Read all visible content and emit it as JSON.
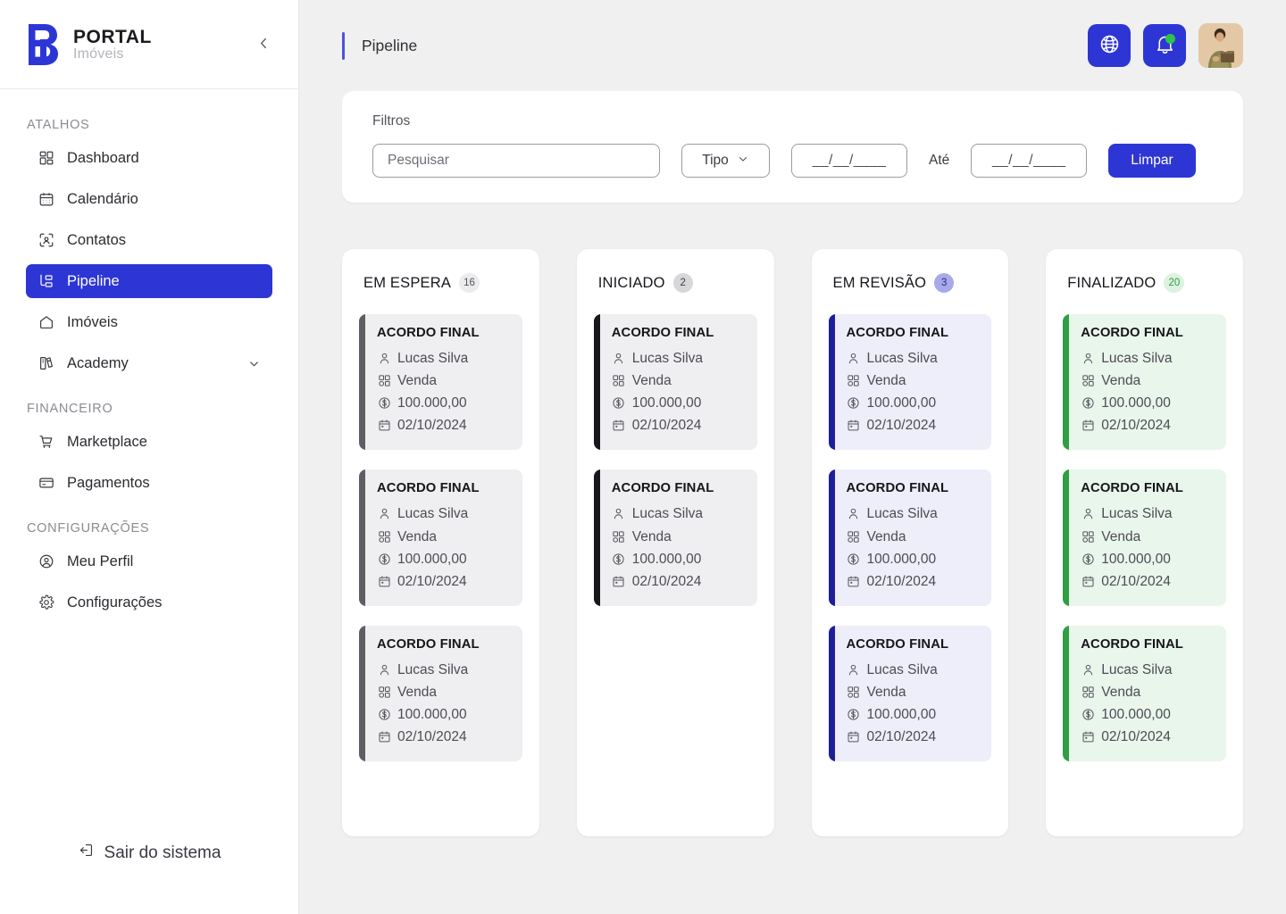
{
  "sidebar": {
    "brand": {
      "title": "PORTAL",
      "subtitle": "Imóveis",
      "logo_icon": "portal-b-logo"
    },
    "collapse_icon": "chevron-left-icon",
    "groups": [
      {
        "label": "ATALHOS",
        "items": [
          {
            "label": "Dashboard",
            "icon": "dashboard-icon",
            "active": false
          },
          {
            "label": "Calendário",
            "icon": "calendar-icon",
            "active": false
          },
          {
            "label": "Contatos",
            "icon": "contacts-icon",
            "active": false
          },
          {
            "label": "Pipeline",
            "icon": "pipeline-icon",
            "active": true
          },
          {
            "label": "Imóveis",
            "icon": "home-icon",
            "active": false
          },
          {
            "label": "Academy",
            "icon": "academy-book-icon",
            "active": false,
            "chevron": "chevron-down-icon"
          }
        ]
      },
      {
        "label": "FINANCEIRO",
        "items": [
          {
            "label": "Marketplace",
            "icon": "cart-icon",
            "active": false
          },
          {
            "label": "Pagamentos",
            "icon": "credit-card-icon",
            "active": false
          }
        ]
      },
      {
        "label": "CONFIGURAÇÕES",
        "items": [
          {
            "label": "Meu Perfil",
            "icon": "user-circle-icon",
            "active": false
          },
          {
            "label": "Configurações",
            "icon": "gear-icon",
            "active": false
          }
        ]
      }
    ],
    "logout": {
      "label": "Sair do sistema",
      "icon": "logout-icon"
    }
  },
  "header": {
    "title": "Pipeline",
    "actions": [
      {
        "name": "language-button",
        "icon": "globe-icon"
      },
      {
        "name": "notifications-button",
        "icon": "bell-icon",
        "has_dot": true
      }
    ],
    "avatar": {
      "name": "user-avatar",
      "alt": "Foto do perfil"
    }
  },
  "filters": {
    "label": "Filtros",
    "search": {
      "placeholder": "Pesquisar",
      "value": ""
    },
    "type_select": {
      "label": "Tipo",
      "icon": "chevron-down-icon"
    },
    "date_from": {
      "value": "__/__/____"
    },
    "separator_label": "Até",
    "date_to": {
      "value": "__/__/____"
    },
    "clear_button": "Limpar"
  },
  "board": {
    "columns": [
      {
        "title": "EM ESPERA",
        "count": "16",
        "badge_bg": "#ececef",
        "badge_fg": "#55555d",
        "stripe": "#5e5e66",
        "card_bg": "#efeff1",
        "cards": [
          {
            "title": "ACORDO FINAL",
            "person": "Lucas Silva",
            "type": "Venda",
            "value": "100.000,00",
            "date": "02/10/2024"
          },
          {
            "title": "ACORDO FINAL",
            "person": "Lucas Silva",
            "type": "Venda",
            "value": "100.000,00",
            "date": "02/10/2024"
          },
          {
            "title": "ACORDO FINAL",
            "person": "Lucas Silva",
            "type": "Venda",
            "value": "100.000,00",
            "date": "02/10/2024"
          }
        ]
      },
      {
        "title": "INICIADO",
        "count": "2",
        "badge_bg": "#d7d7da",
        "badge_fg": "#3b3b43",
        "stripe": "#17171c",
        "card_bg": "#efeff1",
        "cards": [
          {
            "title": "ACORDO FINAL",
            "person": "Lucas Silva",
            "type": "Venda",
            "value": "100.000,00",
            "date": "02/10/2024"
          },
          {
            "title": "ACORDO FINAL",
            "person": "Lucas Silva",
            "type": "Venda",
            "value": "100.000,00",
            "date": "02/10/2024"
          }
        ]
      },
      {
        "title": "EM REVISÃO",
        "count": "3",
        "badge_bg": "#a7a9ea",
        "badge_fg": "#2a2f7a",
        "stripe": "#1c1f96",
        "card_bg": "#eeeefa",
        "cards": [
          {
            "title": "ACORDO FINAL",
            "person": "Lucas Silva",
            "type": "Venda",
            "value": "100.000,00",
            "date": "02/10/2024"
          },
          {
            "title": "ACORDO FINAL",
            "person": "Lucas Silva",
            "type": "Venda",
            "value": "100.000,00",
            "date": "02/10/2024"
          },
          {
            "title": "ACORDO FINAL",
            "person": "Lucas Silva",
            "type": "Venda",
            "value": "100.000,00",
            "date": "02/10/2024"
          }
        ]
      },
      {
        "title": "FINALIZADO",
        "count": "20",
        "badge_bg": "#ddf2e0",
        "badge_fg": "#2f9e44",
        "stripe": "#2f9e44",
        "card_bg": "#e9f6ec",
        "cards": [
          {
            "title": "ACORDO FINAL",
            "person": "Lucas Silva",
            "type": "Venda",
            "value": "100.000,00",
            "date": "02/10/2024"
          },
          {
            "title": "ACORDO FINAL",
            "person": "Lucas Silva",
            "type": "Venda",
            "value": "100.000,00",
            "date": "02/10/2024"
          },
          {
            "title": "ACORDO FINAL",
            "person": "Lucas Silva",
            "type": "Venda",
            "value": "100.000,00",
            "date": "02/10/2024"
          }
        ]
      }
    ],
    "card_icons": {
      "person": "person-icon",
      "type": "category-icon",
      "value": "dollar-circle-icon",
      "date": "calendar-icon"
    }
  },
  "colors": {
    "brand_blue": "#2d36d4",
    "accent_blue": "#4a52df",
    "green": "#2f9e44",
    "canvas": "#f0f0f0"
  }
}
